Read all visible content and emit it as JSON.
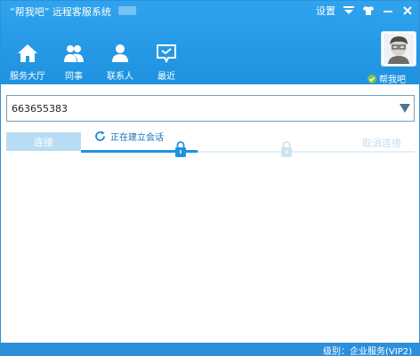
{
  "window": {
    "title": "“帮我吧” 远程客服系统",
    "settings_label": "设置"
  },
  "nav": [
    {
      "label": "服务大厅",
      "icon": "home-icon"
    },
    {
      "label": "同事",
      "icon": "colleague-icon"
    },
    {
      "label": "联系人",
      "icon": "contact-icon"
    },
    {
      "label": "最近",
      "icon": "recent-chat-icon"
    }
  ],
  "user": {
    "brand_label": "帮我吧"
  },
  "connection": {
    "target_id": "663655383",
    "connect_label": "连接",
    "status_text": "正在建立会话",
    "cancel_label": "取消连接",
    "progress": 0.35
  },
  "footer": {
    "level_label": "级别：",
    "level_value": "企业服务(VIP2)"
  },
  "colors": {
    "header_blue": "#1f92e0",
    "accent_blue": "#2d8fda",
    "button_disabled": "#b9dcf5",
    "status_text": "#1a73c0"
  }
}
